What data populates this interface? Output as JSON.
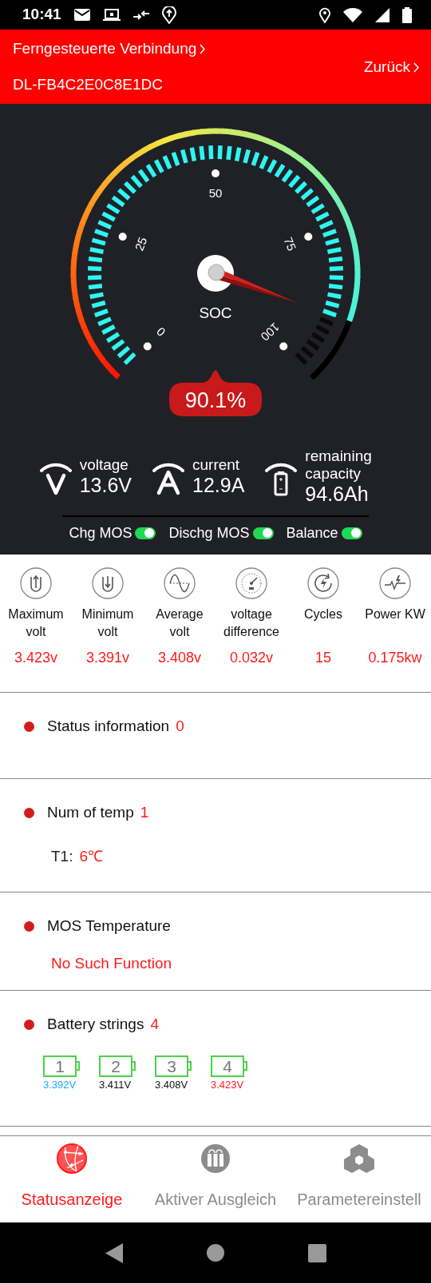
{
  "status_bar": {
    "time": "10:41"
  },
  "header": {
    "title": "Ferngesteuerte Verbindung",
    "device": "DL-FB4C2E0C8E1DC",
    "back": "Zurück"
  },
  "gauge": {
    "label": "SOC",
    "reading": "90.1%",
    "scale": [
      "0",
      "25",
      "50",
      "75",
      "100"
    ]
  },
  "readings": [
    {
      "kind": "voltage",
      "label": "voltage",
      "value": "13.6V"
    },
    {
      "kind": "current",
      "label": "current",
      "value": "12.9A"
    },
    {
      "kind": "capacity",
      "label": "remaining capacity",
      "value": "94.6Ah"
    }
  ],
  "switches": [
    {
      "label": "Chg MOS",
      "on": true
    },
    {
      "label": "Dischg MOS",
      "on": true
    },
    {
      "label": "Balance",
      "on": true
    }
  ],
  "metrics": [
    {
      "kind": "max",
      "label": "Maximum volt",
      "value": "3.423v"
    },
    {
      "kind": "min",
      "label": "Minimum volt",
      "value": "3.391v"
    },
    {
      "kind": "avg",
      "label": "Average volt",
      "value": "3.408v"
    },
    {
      "kind": "diff",
      "label": "voltage difference",
      "value": "0.032v"
    },
    {
      "kind": "cycles",
      "label": "Cycles",
      "value": "15"
    },
    {
      "kind": "power",
      "label": "Power KW",
      "value": "0.175kw"
    }
  ],
  "sections": [
    {
      "kind": "status",
      "title": "Status information",
      "count": "0"
    },
    {
      "kind": "temp",
      "title": "Num of temp",
      "count": "1",
      "sensors": [
        {
          "name": "T1:",
          "value": "6℃"
        }
      ]
    },
    {
      "kind": "mos",
      "title": "MOS Temperature",
      "message": "No Such Function"
    },
    {
      "kind": "cells",
      "title": "Battery strings",
      "count": "4",
      "cells": [
        {
          "number": "1",
          "voltage": "3.392V",
          "color": "#1ea7f5"
        },
        {
          "number": "2",
          "voltage": "3.411V",
          "color": "#111111"
        },
        {
          "number": "3",
          "voltage": "3.408V",
          "color": "#111111"
        },
        {
          "number": "4",
          "voltage": "3.423V",
          "color": "#ff1a1a"
        }
      ]
    }
  ],
  "tabs": [
    {
      "kind": "status",
      "label": "Statusanzeige",
      "selected": true
    },
    {
      "kind": "balance",
      "label": "Aktiver Ausgleich",
      "selected": false
    },
    {
      "kind": "params",
      "label": "Parametereinstell",
      "selected": false
    }
  ]
}
